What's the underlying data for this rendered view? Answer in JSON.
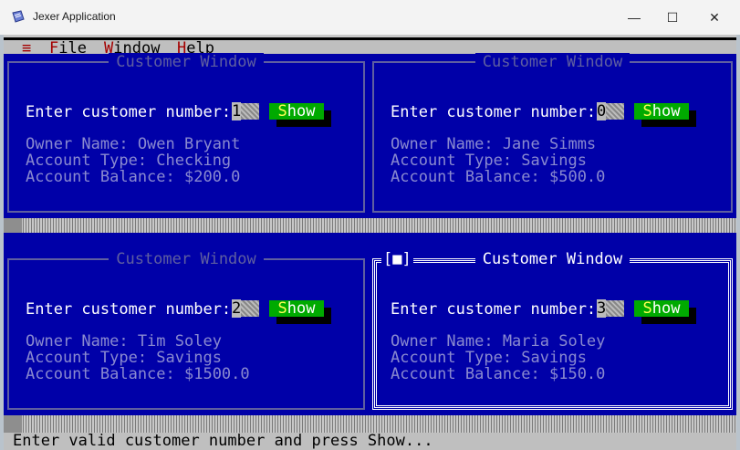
{
  "window": {
    "title": "Jexer Application",
    "minimize_glyph": "—",
    "maximize_glyph": "☐",
    "close_glyph": "✕"
  },
  "menu": {
    "system_glyph": "≡",
    "items": [
      {
        "hot": "F",
        "rest": "ile"
      },
      {
        "hot": "W",
        "rest": "indow"
      },
      {
        "hot": "H",
        "rest": "elp"
      }
    ]
  },
  "customer_windows": [
    {
      "title": "Customer Window",
      "prompt": "Enter customer number:",
      "number": "1",
      "button_hot": "S",
      "button_rest": "how",
      "owner": "Owner Name: Owen Bryant",
      "type": "Account Type: Checking",
      "balance": "Account Balance: $200.0"
    },
    {
      "title": "Customer Window",
      "prompt": "Enter customer number:",
      "number": "0",
      "button_hot": "S",
      "button_rest": "how",
      "owner": "Owner Name: Jane Simms",
      "type": "Account Type: Savings",
      "balance": "Account Balance: $500.0"
    },
    {
      "title": "Customer Window",
      "prompt": "Enter customer number:",
      "number": "2",
      "button_hot": "S",
      "button_rest": "how",
      "owner": "Owner Name: Tim Soley",
      "type": "Account Type: Savings",
      "balance": "Account Balance: $1500.0"
    },
    {
      "title": "Customer Window",
      "prompt": "Enter customer number:",
      "number": "3",
      "button_hot": "S",
      "button_rest": "how",
      "owner": "Owner Name: Maria Soley",
      "type": "Account Type: Savings",
      "balance": "Account Balance: $150.0",
      "close_box": "[■]"
    }
  ],
  "status": "Enter valid customer number and press Show..."
}
